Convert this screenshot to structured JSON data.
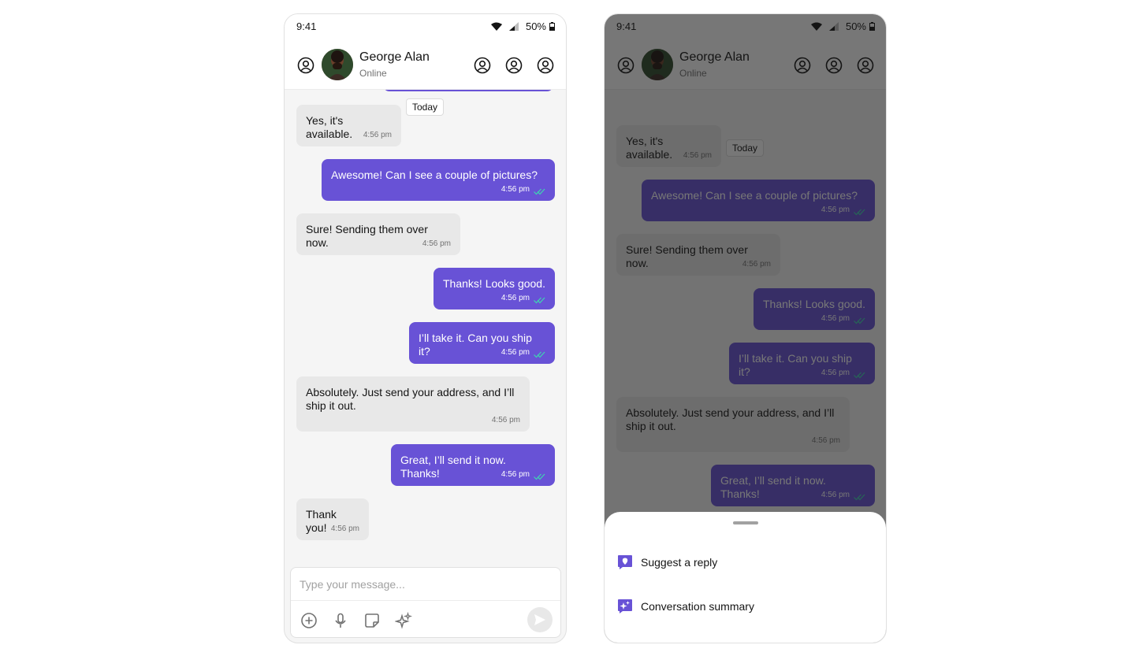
{
  "status_bar": {
    "time": "9:41",
    "battery": "50%"
  },
  "contact": {
    "name": "George Alan",
    "status": "Online"
  },
  "chat": {
    "date_chip": "Today",
    "messages": [
      {
        "text": "Yes, it's available.",
        "time": "4:56 pm",
        "direction": "in"
      },
      {
        "text": "Awesome! Can I see a couple of pictures?",
        "time": "4:56 pm",
        "direction": "out"
      },
      {
        "text": "Sure! Sending them over now.",
        "time": "4:56 pm",
        "direction": "in"
      },
      {
        "text": "Thanks! Looks good.",
        "time": "4:56 pm",
        "direction": "out"
      },
      {
        "text": "I’ll take it. Can you ship it?",
        "time": "4:56 pm",
        "direction": "out"
      },
      {
        "text": "Absolutely. Just send your address, and I’ll ship it out.",
        "time": "4:56 pm",
        "direction": "in"
      },
      {
        "text": "Great, I’ll send it now. Thanks!",
        "time": "4:56 pm",
        "direction": "out"
      },
      {
        "text": "Thank you!",
        "time": "4:56 pm",
        "direction": "in"
      }
    ]
  },
  "composer": {
    "placeholder": "Type your message..."
  },
  "ai_sheet": {
    "items": [
      {
        "label": "Suggest a reply",
        "icon": "suggest-reply-icon"
      },
      {
        "label": "Conversation summary",
        "icon": "sparkle-summary-icon"
      }
    ]
  },
  "colors": {
    "accent": "#6852d6",
    "incoming": "#e8e8e8",
    "read_tick": "#3dd6b0",
    "background": "#f5f5f5"
  },
  "icons": [
    "user-circle-icon",
    "wifi-icon",
    "signal-icon",
    "battery-icon",
    "plus-circle-icon",
    "mic-icon",
    "sticker-icon",
    "sparkle-icon",
    "send-icon"
  ]
}
